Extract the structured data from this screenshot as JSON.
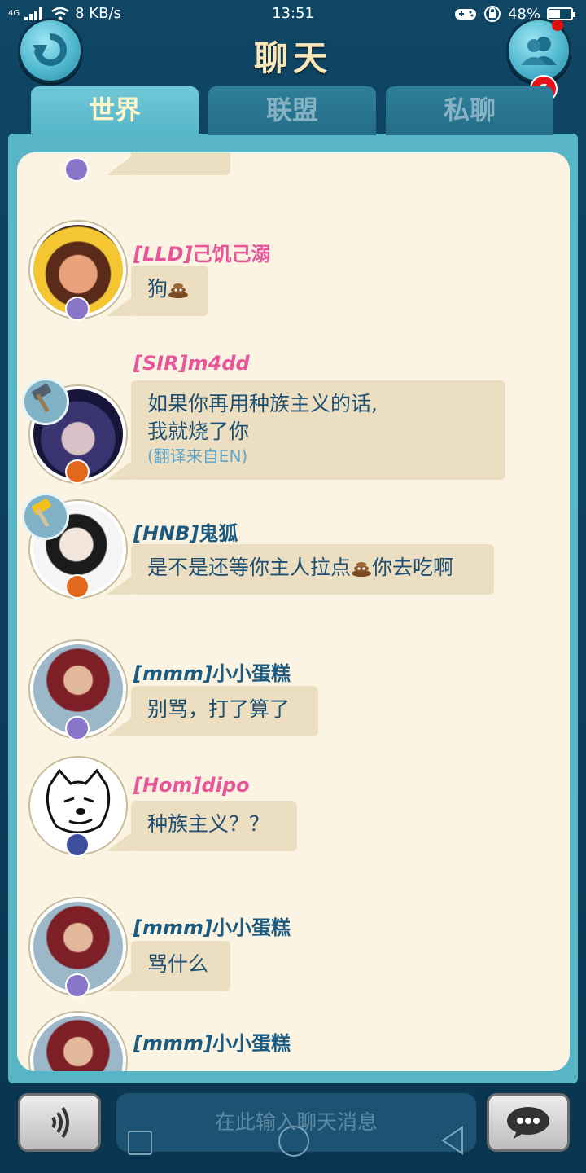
{
  "status_bar": {
    "network": "4G",
    "speed": "8 KB/s",
    "time": "13:51",
    "battery": "48%"
  },
  "header": {
    "title": "聊天",
    "friend_badge_count": "1"
  },
  "tabs": [
    {
      "label": "世界",
      "active": true
    },
    {
      "label": "联盟",
      "active": false
    },
    {
      "label": "私聊",
      "active": false
    }
  ],
  "messages": [
    {
      "tag": "[LLD]",
      "name": "己饥己溺",
      "name_color": "pink",
      "text": "狗",
      "has_poo": true
    },
    {
      "tag": "[SIR]",
      "name": "m4dd",
      "name_color": "pink",
      "lines": [
        "如果你再用种族主义的话,",
        "我就烧了你"
      ],
      "translation": "(翻译来自EN)"
    },
    {
      "tag": "[HNB]",
      "name": "鬼狐",
      "name_color": "blue",
      "text_a": "是不是还等你主人拉点",
      "text_b": "你去吃啊"
    },
    {
      "tag": "[mmm]",
      "name": "小小蛋糕",
      "name_color": "blue",
      "text": "别骂，打了算了"
    },
    {
      "tag": "[Hom]",
      "name": "dipo",
      "name_color": "pink",
      "text": "种族主义？？"
    },
    {
      "tag": "[mmm]",
      "name": "小小蛋糕",
      "name_color": "blue",
      "text": "骂什么"
    },
    {
      "tag": "[mmm]",
      "name": "小小蛋糕",
      "name_color": "blue"
    }
  ],
  "input": {
    "placeholder": "在此输入聊天消息"
  },
  "colors": {
    "pink_name": "#e8559a",
    "blue_name": "#1c5a80",
    "bubble": "#ecdfc1",
    "chat_bg": "#fbf4e3"
  }
}
